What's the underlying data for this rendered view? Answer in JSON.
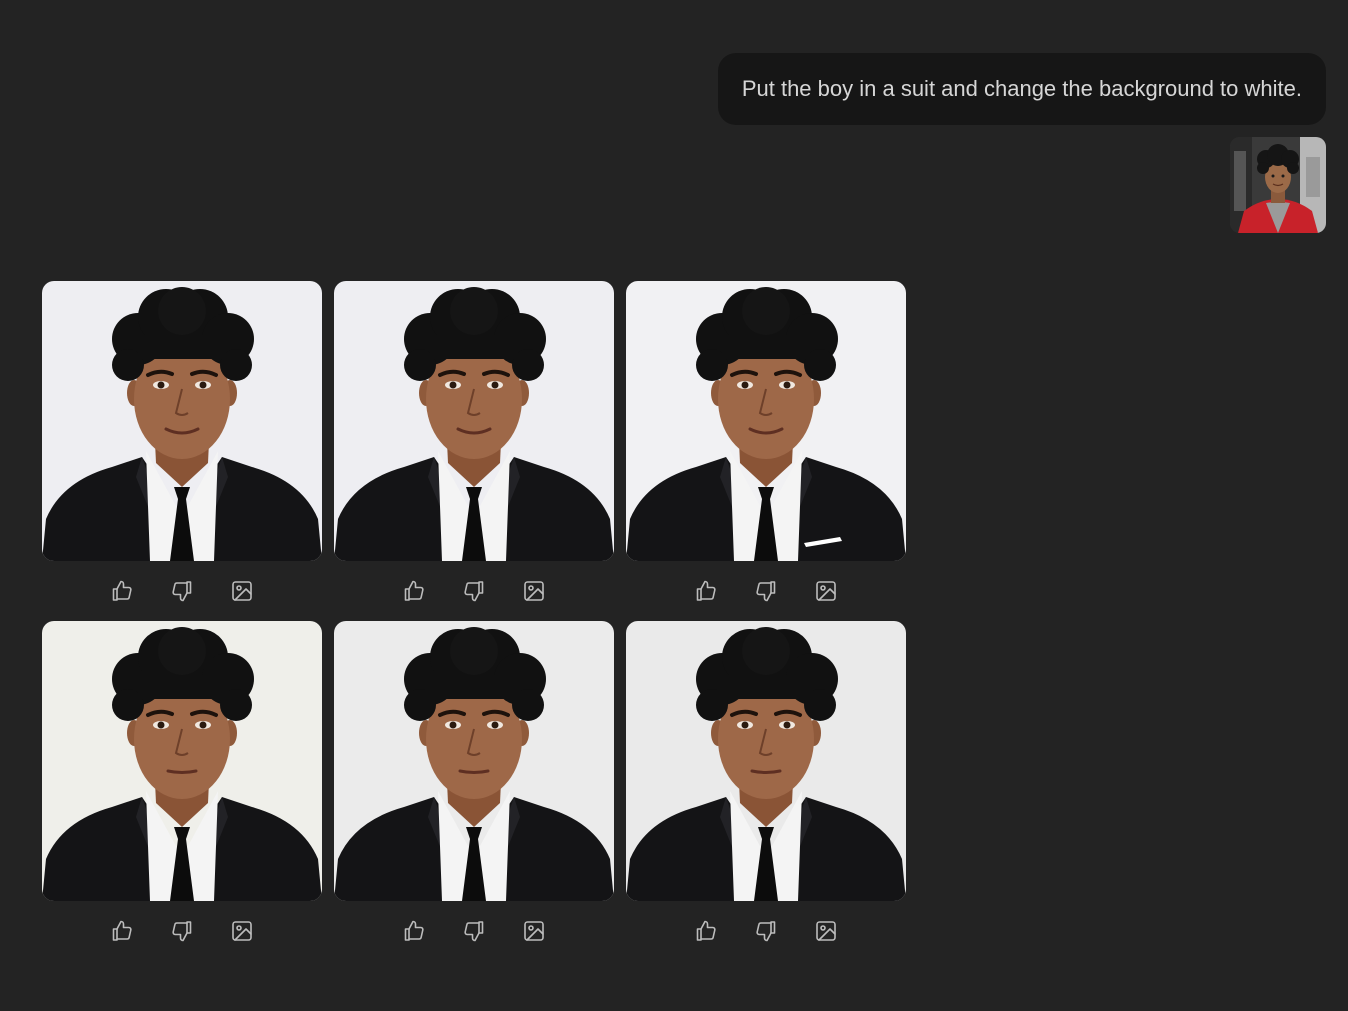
{
  "conversation": {
    "user_message": "Put the boy in a suit and change the background to white."
  },
  "attachment": {
    "icon": "portrait-thumbnail",
    "jacket_color": "#c8222a"
  },
  "results": [
    {
      "background": "#eeeef2",
      "tie": "black",
      "variant": "smile"
    },
    {
      "background": "#eeeef2",
      "tie": "black",
      "variant": "smile"
    },
    {
      "background": "#f1f1f3",
      "tie": "black",
      "variant": "smile-pocket"
    },
    {
      "background": "#efefea",
      "tie": "black",
      "variant": "neutral"
    },
    {
      "background": "#ebebeb",
      "tie": "black",
      "variant": "neutral"
    },
    {
      "background": "#eaeaea",
      "tie": "black",
      "variant": "neutral"
    }
  ],
  "actions": [
    "thumbs-up-icon",
    "thumbs-down-icon",
    "image-icon"
  ],
  "colors": {
    "page_background": "#232323",
    "bubble_background": "#161616",
    "text": "#d6d6d6",
    "icon": "#bcbcbc"
  }
}
